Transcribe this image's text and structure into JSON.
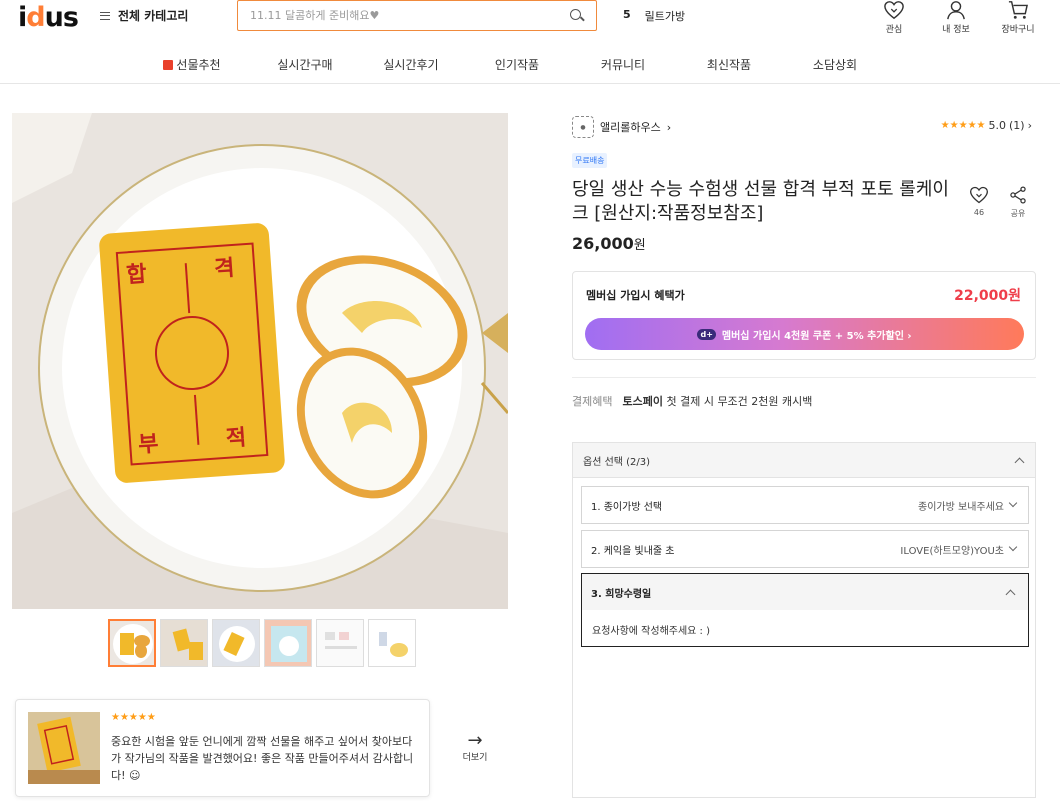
{
  "header": {
    "logo": "idus",
    "category_label": "전체 카테고리",
    "search_placeholder": "11.11 달콤하게 준비해요♥",
    "rank_num": "5",
    "rank_text": "릴트가방",
    "icons": [
      {
        "name": "heart-icon",
        "label": "관심"
      },
      {
        "name": "user-icon",
        "label": "내 정보"
      },
      {
        "name": "cart-icon",
        "label": "장바구니"
      }
    ]
  },
  "nav": [
    "선물추천",
    "실시간구매",
    "실시간후기",
    "인기작품",
    "커뮤니티",
    "최신작품",
    "소담상회"
  ],
  "review": {
    "stars": "★★★★★",
    "text": "중요한 시험을 앞둔 언니에게 깜짝 선물을 해주고 싶어서 찾아보다가 작가님의 작품을 발견했어요! 좋은 작품 만들어주셔서 감사합니다! ☺",
    "more_label": "더보기"
  },
  "product": {
    "seller": "앨리롤하우스",
    "rating_stars": "★★★★★",
    "rating_score": "5.0",
    "rating_count": "(1)",
    "badge": "무료배송",
    "title": "당일 생산 수능 수험생 선물 합격 부적 포토 롤케이크 [원산지:작품정보참조]",
    "like_count": "46",
    "share_label": "공유",
    "price": "26,000",
    "price_unit": "원"
  },
  "membership": {
    "label": "멤버십 가입시 혜택가",
    "price": "22,000원",
    "button_label": "멤버십 가입시  4천원 쿠폰 + 5% 추가할인 ›",
    "badge": "d+"
  },
  "payment": {
    "label": "결제혜택",
    "brand": "토스페이",
    "text": "첫 결제 시 무조건 2천원 캐시백"
  },
  "options": {
    "header": "옵션 선택 (2/3)",
    "rows": [
      {
        "label": "1. 종이가방 선택",
        "value": "종이가방 보내주세요"
      },
      {
        "label": "2. 케익을 빛내줄 초",
        "value": "ILOVE(하트모양)YOU초"
      }
    ],
    "open": {
      "label": "3. 희망수령일",
      "placeholder": "요청사항에 작성해주세요 : )"
    }
  },
  "colors": {
    "accent": "#ff7e36",
    "member_price": "#ef3e4a",
    "star": "#ff9d17"
  }
}
